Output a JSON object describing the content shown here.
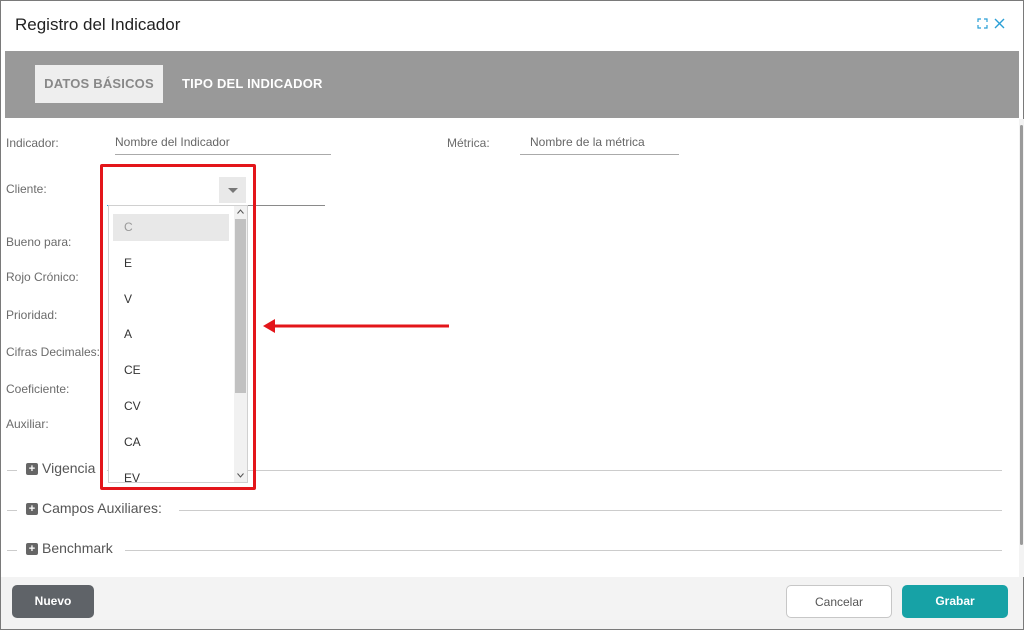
{
  "modal": {
    "title": "Registro del Indicador",
    "header_icons": [
      "expand-icon",
      "close-icon"
    ]
  },
  "tabs": [
    {
      "label": "DATOS BÁSICOS",
      "active": true
    },
    {
      "label": "TIPO DEL INDICADOR",
      "active": false
    }
  ],
  "form": {
    "indicador_label": "Indicador:",
    "indicador_placeholder": "Nombre del Indicador",
    "metrica_label": "Métrica:",
    "metrica_placeholder": "Nombre de la métrica",
    "cliente_label": "Cliente:",
    "cliente_value": "",
    "bueno_para_label": "Bueno para:",
    "rojo_cronico_label": "Rojo Crónico:",
    "prioridad_label": "Prioridad:",
    "cifras_decimales_label": "Cifras Decimales:",
    "coeficiente_label": "Coeficiente:",
    "auxiliar_label": "Auxiliar:"
  },
  "dropdown": {
    "options": [
      "C",
      "E",
      "V",
      "A",
      "CE",
      "CV",
      "CA",
      "EV"
    ],
    "highlighted_index": 0
  },
  "sections": [
    {
      "label": "Vigencia"
    },
    {
      "label": "Campos Auxiliares:"
    },
    {
      "label": "Benchmark"
    }
  ],
  "footer": {
    "nuevo_label": "Nuevo",
    "cancelar_label": "Cancelar",
    "grabar_label": "Grabar"
  },
  "colors": {
    "tabbar": "#999999",
    "accent_blue": "#2a9fd6",
    "grabar": "#17a2a6",
    "nuevo": "#5f6368",
    "annotation_red": "#e3151a"
  }
}
